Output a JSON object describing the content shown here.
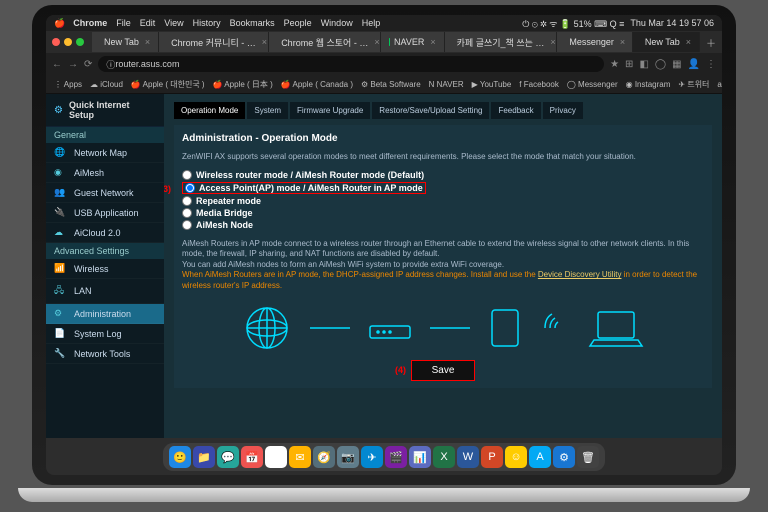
{
  "menubar": {
    "app": "Chrome",
    "items": [
      "File",
      "Edit",
      "View",
      "History",
      "Bookmarks",
      "People",
      "Window",
      "Help"
    ],
    "status": {
      "wifi": "⋮",
      "battery": "51%",
      "bt": "",
      "lang": "⌨",
      "day": "Thu Mar 14",
      "time": "19 57 06"
    }
  },
  "tabs": [
    {
      "label": "New Tab",
      "fav": "#666"
    },
    {
      "label": "Chrome 커뮤니티 - …",
      "fav": "#4285f4"
    },
    {
      "label": "Chrome 웹 스토어 - …",
      "fav": "#4285f4"
    },
    {
      "label": "NAVER",
      "fav": "#03c75a"
    },
    {
      "label": "카페 글쓰기_책 쓰는 …",
      "fav": "#888"
    },
    {
      "label": "Messenger",
      "fav": "#0084ff"
    },
    {
      "label": "New Tab",
      "fav": "#666",
      "active": true
    }
  ],
  "url": "router.asus.com",
  "bookmarks": [
    "⋮ Apps",
    "☁ iCloud",
    "🍎 Apple ( 대한민국 )",
    "🍎 Apple ( 日本 )",
    "🍎 Apple ( Canada )",
    "⚙ Beta Software",
    "N NAVER",
    "▶ YouTube",
    "f Facebook",
    "◯ Messenger",
    "◉ Instagram",
    "✈ 트위터",
    "a Amazon"
  ],
  "sidebar": {
    "quick": "Quick Internet Setup",
    "sections": [
      {
        "title": "General",
        "items": [
          {
            "ico": "🌐",
            "label": "Network Map"
          },
          {
            "ico": "◉",
            "label": "AiMesh"
          },
          {
            "ico": "👥",
            "label": "Guest Network"
          },
          {
            "ico": "🔌",
            "label": "USB Application"
          },
          {
            "ico": "☁",
            "label": "AiCloud 2.0"
          }
        ]
      },
      {
        "title": "Advanced Settings",
        "items": [
          {
            "ico": "📶",
            "label": "Wireless"
          },
          {
            "ico": "🖧",
            "label": "LAN"
          },
          {
            "ico": "⚙",
            "label": "Administration",
            "active": true
          },
          {
            "ico": "📄",
            "label": "System Log"
          },
          {
            "ico": "🔧",
            "label": "Network Tools"
          }
        ]
      }
    ]
  },
  "subtabs": [
    "Operation Mode",
    "System",
    "Firmware Upgrade",
    "Restore/Save/Upload Setting",
    "Feedback",
    "Privacy"
  ],
  "page": {
    "title": "Administration - Operation Mode",
    "desc": "ZenWIFI AX supports several operation modes to meet different requirements. Please select the mode that match your situation.",
    "radios": [
      {
        "label": "Wireless router mode / AiMesh Router mode (Default)"
      },
      {
        "label": "Access Point(AP) mode / AiMesh Router in AP mode",
        "hl": true,
        "step": "(3)"
      },
      {
        "label": "Repeater mode"
      },
      {
        "label": "Media Bridge"
      },
      {
        "label": "AiMesh Node"
      }
    ],
    "info1": "AiMesh Routers in AP mode connect to a wireless router through an Ethernet cable to extend the wireless signal to other network clients. In this mode, the firewall, IP sharing, and NAT functions are disabled by default.",
    "info2": "You can add AiMesh nodes to form an AiMesh WiFi system to provide extra WiFi coverage.",
    "warn": "When AiMesh Routers are in AP mode, the DHCP-assigned IP address changes. Install and use the ",
    "warnlink": "Device Discovery Utility",
    "warn2": " in order to detect the wireless router's IP address.",
    "save": "Save",
    "savestep": "(4)"
  },
  "dock": [
    {
      "c": "#1e88e5",
      "t": "🙂"
    },
    {
      "c": "#3949ab",
      "t": "📁"
    },
    {
      "c": "#26a69a",
      "t": "💬"
    },
    {
      "c": "#ef5350",
      "t": "📅"
    },
    {
      "c": "#fff",
      "t": "14"
    },
    {
      "c": "#ffb300",
      "t": "✉"
    },
    {
      "c": "#546e7a",
      "t": "🧭"
    },
    {
      "c": "#607d8b",
      "t": "📷"
    },
    {
      "c": "#0288d1",
      "t": "✈"
    },
    {
      "c": "#7b1fa2",
      "t": "🎬"
    },
    {
      "c": "#5c6bc0",
      "t": "📊"
    },
    {
      "c": "#217346",
      "t": "X"
    },
    {
      "c": "#2b579a",
      "t": "W"
    },
    {
      "c": "#d24726",
      "t": "P"
    },
    {
      "c": "#ffcc00",
      "t": "☺"
    },
    {
      "c": "#03a9f4",
      "t": "A"
    },
    {
      "c": "#1976d2",
      "t": "⚙"
    },
    {
      "c": "#424242",
      "t": "🗑"
    }
  ]
}
